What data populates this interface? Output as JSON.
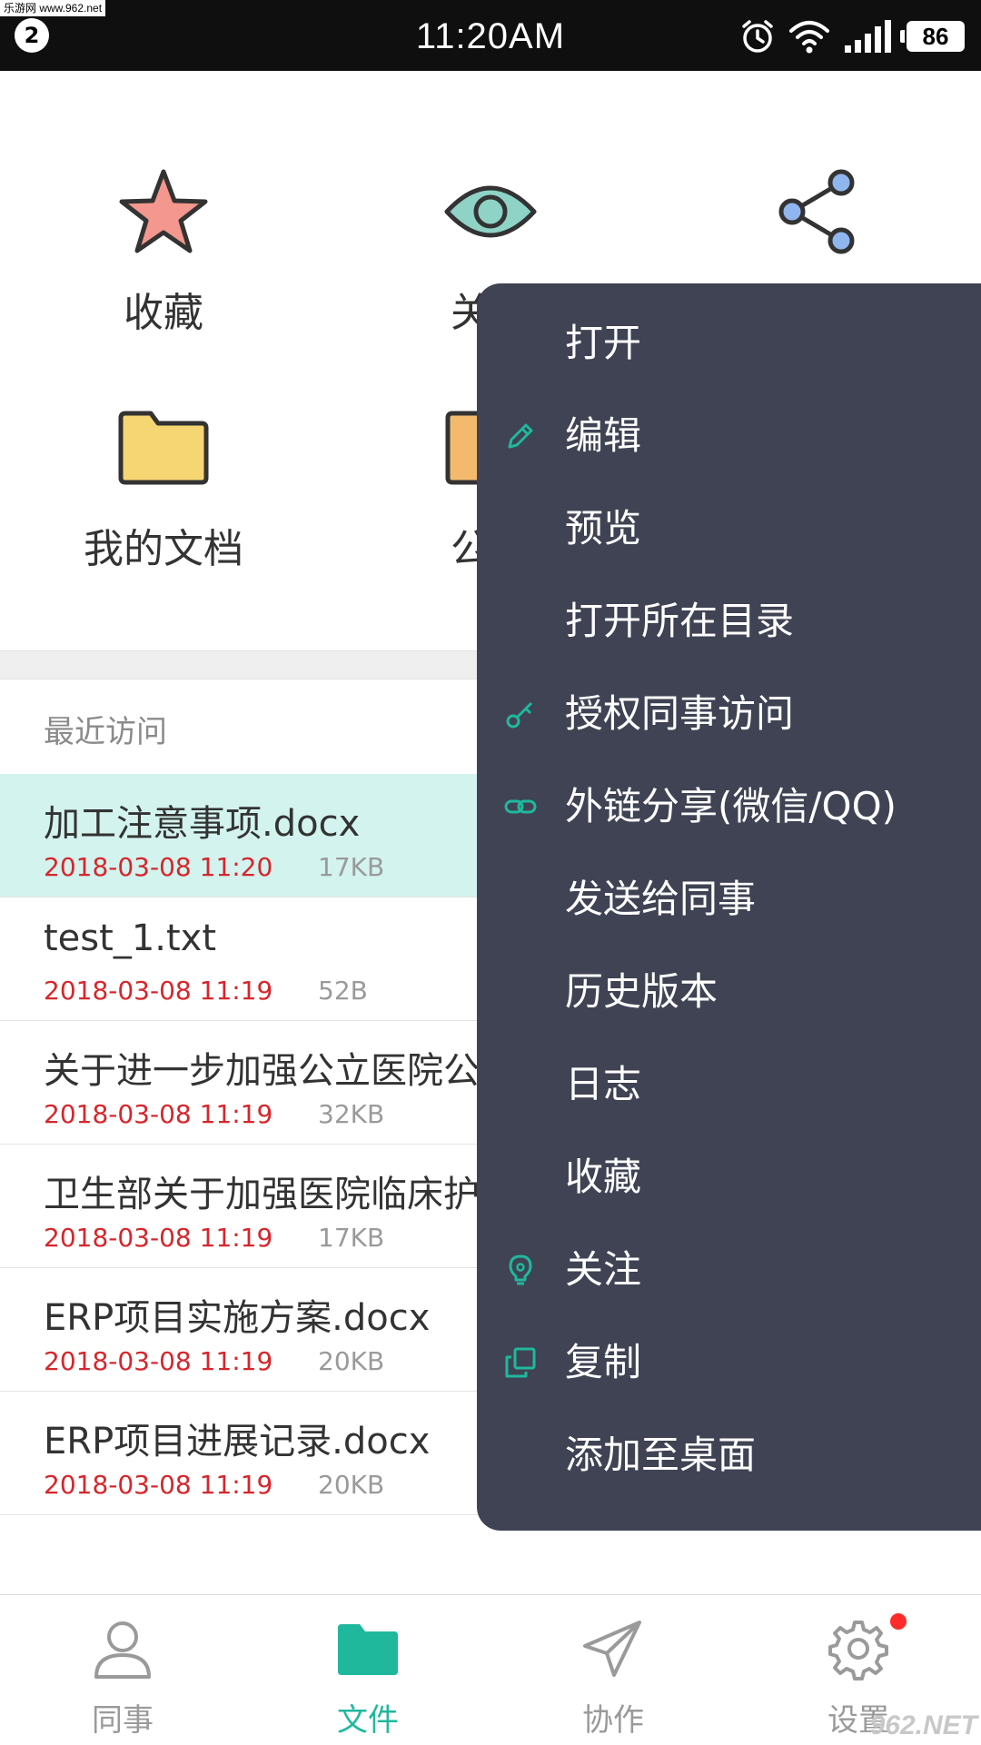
{
  "status_bar": {
    "watermark": "乐游网 www.962.net",
    "notification_count": "2",
    "time": "11:20AM",
    "battery": "86"
  },
  "quick_actions": [
    {
      "label": "收藏",
      "icon": "star-icon"
    },
    {
      "label": "关注",
      "icon": "eye-icon"
    },
    {
      "label": "",
      "icon": "share-icon"
    },
    {
      "label": "我的文档",
      "icon": "folder-icon"
    },
    {
      "label": "公司",
      "icon": "folder-icon"
    }
  ],
  "recent": {
    "title": "最近访问",
    "files": [
      {
        "name": "加工注意事项.docx",
        "time": "2018-03-08 11:20",
        "size": "17KB",
        "selected": true
      },
      {
        "name": "test_1.txt",
        "time": "2018-03-08 11:19",
        "size": "52B",
        "selected": false
      },
      {
        "name": "关于进一步加强公立医院公",
        "time": "2018-03-08 11:19",
        "size": "32KB",
        "selected": false
      },
      {
        "name": "卫生部关于加强医院临床护",
        "time": "2018-03-08 11:19",
        "size": "17KB",
        "selected": false
      },
      {
        "name": "ERP项目实施方案.docx",
        "time": "2018-03-08 11:19",
        "size": "20KB",
        "selected": false
      },
      {
        "name": "ERP项目进展记录.docx",
        "time": "2018-03-08 11:19",
        "size": "20KB",
        "selected": false
      }
    ]
  },
  "context_menu": {
    "items": [
      {
        "label": "打开",
        "icon": ""
      },
      {
        "label": "编辑",
        "icon": "pencil-icon"
      },
      {
        "label": "预览",
        "icon": ""
      },
      {
        "label": "打开所在目录",
        "icon": ""
      },
      {
        "label": "授权同事访问",
        "icon": "key-icon"
      },
      {
        "label": "外链分享(微信/QQ)",
        "icon": "link-icon"
      },
      {
        "label": "发送给同事",
        "icon": ""
      },
      {
        "label": "历史版本",
        "icon": ""
      },
      {
        "label": "日志",
        "icon": ""
      },
      {
        "label": "收藏",
        "icon": ""
      },
      {
        "label": "关注",
        "icon": "lightbulb-icon"
      },
      {
        "label": "复制",
        "icon": "copy-icon"
      },
      {
        "label": "添加至桌面",
        "icon": ""
      }
    ]
  },
  "bottom_nav": {
    "items": [
      {
        "label": "同事",
        "icon": "person-icon",
        "active": false
      },
      {
        "label": "文件",
        "icon": "folder-icon",
        "active": true
      },
      {
        "label": "协作",
        "icon": "send-icon",
        "active": false
      },
      {
        "label": "设置",
        "icon": "gear-icon",
        "active": false
      }
    ],
    "watermark": "962.NET"
  },
  "colors": {
    "accent": "#20b89d",
    "menu_bg": "#3f4353",
    "selected_row": "#d3f3ee",
    "time_red": "#d6262c"
  }
}
